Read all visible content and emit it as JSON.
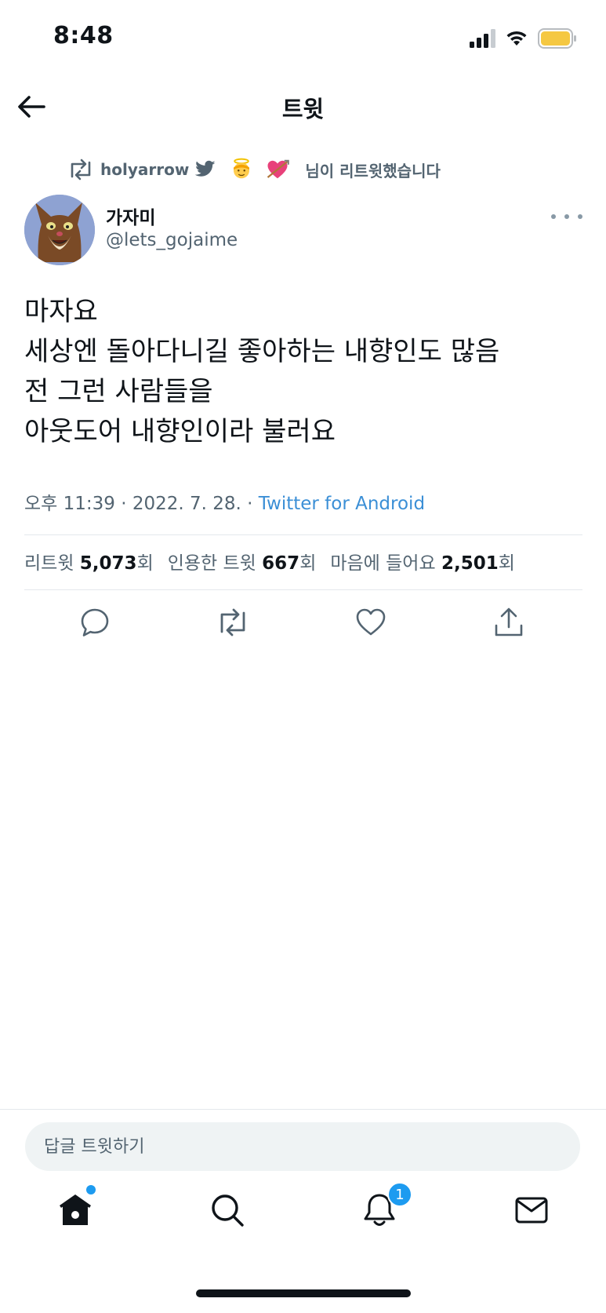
{
  "status_bar": {
    "time": "8:48"
  },
  "header": {
    "title": "트윗"
  },
  "retweet_context": {
    "user": "holyarrow",
    "suffix": "님이 리트윗했습니다"
  },
  "author": {
    "display_name": "가자미",
    "handle": "@lets_gojaime"
  },
  "tweet": {
    "lines": [
      "마자요",
      "세상엔 돌아다니길 좋아하는 내향인도 많음",
      "전 그런 사람들을",
      "아웃도어 내향인이라 불러요"
    ],
    "timestamp": "오후 11:39 · 2022. 7. 28. · ",
    "source": "Twitter for Android"
  },
  "stats": {
    "retweets": {
      "label": "리트윗",
      "count": "5,073",
      "unit": "회"
    },
    "quotes": {
      "label": "인용한 트윗",
      "count": "667",
      "unit": "회"
    },
    "likes": {
      "label": "마음에 들어요",
      "count": "2,501",
      "unit": "회"
    }
  },
  "reply": {
    "placeholder": "답글 트윗하기"
  },
  "tabbar": {
    "notifications_badge": "1"
  },
  "colors": {
    "accent": "#1d9bf0",
    "text": "#0f1419",
    "secondary": "#536471",
    "battery": "#f5c842"
  },
  "icons": {
    "back": "arrow-left-icon",
    "retweet_context": "retweet-icon",
    "more": "more-horizontal-icon",
    "actions": [
      "reply-icon",
      "retweet-icon",
      "like-icon",
      "share-icon"
    ],
    "tabs": [
      "home-icon",
      "search-icon",
      "notifications-icon",
      "messages-icon"
    ]
  }
}
